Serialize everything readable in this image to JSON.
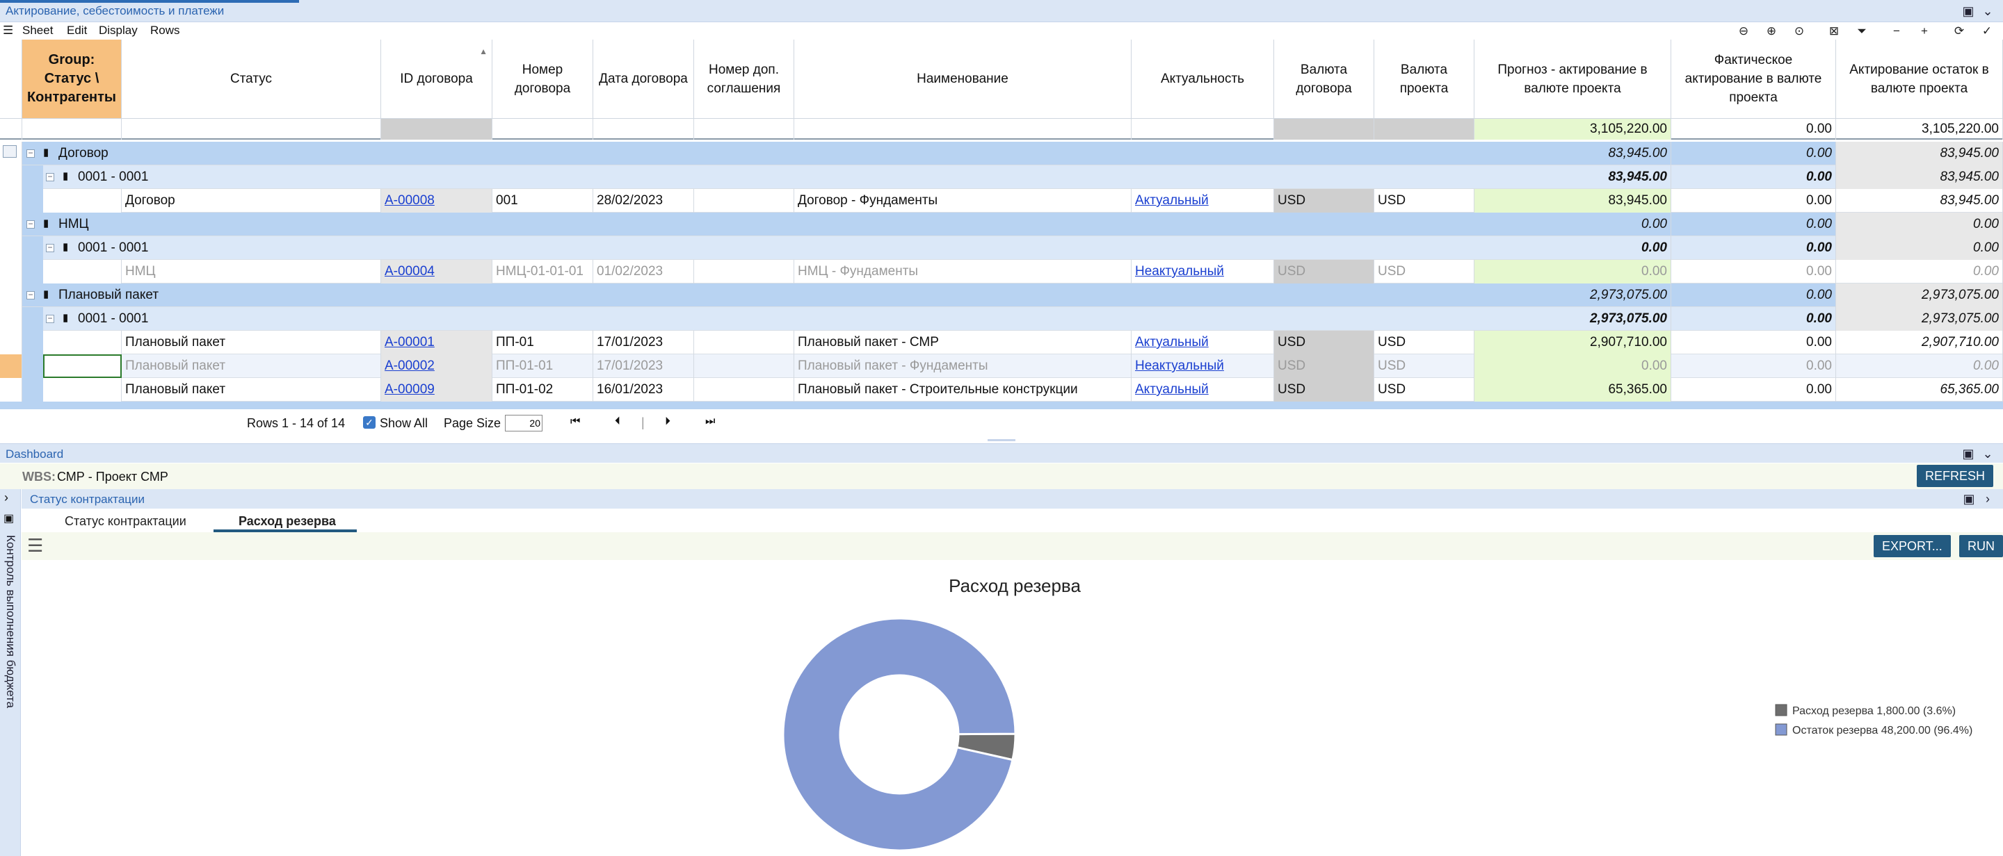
{
  "window": {
    "title": "Актирование, себестоимость и платежи"
  },
  "menu": [
    "Sheet",
    "Edit",
    "Display",
    "Rows"
  ],
  "columns": {
    "group": "Group: Статус \\ Контрагенты",
    "status": "Статус",
    "id": "ID договора",
    "number": "Номер договора",
    "date": "Дата договора",
    "addnum": "Номер доп. соглашения",
    "name": "Наименование",
    "actual": "Актуальность",
    "cur_contract": "Валюта договора",
    "cur_project": "Валюта проекта",
    "forecast": "Прогноз - актирование в валюте проекта",
    "fact": "Фактическое актирование в валюте проекта",
    "rest": "Актирование остаток в валюте проекта"
  },
  "totals": {
    "forecast": "3,105,220.00",
    "fact": "0.00",
    "rest": "3,105,220.00"
  },
  "rows": [
    {
      "kind": "g1",
      "label": "Договор",
      "forecast": "83,945.00",
      "fact": "0.00",
      "rest": "83,945.00"
    },
    {
      "kind": "g2",
      "label": "0001 - 0001",
      "forecast": "83,945.00",
      "fact": "0.00",
      "rest": "83,945.00"
    },
    {
      "kind": "d",
      "status": "Договор",
      "id": "A-00008",
      "number": "001",
      "date": "28/02/2023",
      "name": "Договор - Фундаменты",
      "actual": "Актуальный",
      "cc": "USD",
      "cp": "USD",
      "forecast": "83,945.00",
      "fact": "0.00",
      "rest": "83,945.00",
      "dim": false
    },
    {
      "kind": "g1",
      "label": "НМЦ",
      "forecast": "0.00",
      "fact": "0.00",
      "rest": "0.00"
    },
    {
      "kind": "g2",
      "label": "0001 - 0001",
      "forecast": "0.00",
      "fact": "0.00",
      "rest": "0.00"
    },
    {
      "kind": "d",
      "status": "НМЦ",
      "id": "A-00004",
      "number": "НМЦ-01-01-01",
      "date": "01/02/2023",
      "name": "НМЦ - Фундаменты",
      "actual": "Неактуальный",
      "cc": "USD",
      "cp": "USD",
      "forecast": "0.00",
      "fact": "0.00",
      "rest": "0.00",
      "dim": true
    },
    {
      "kind": "g1",
      "label": "Плановый пакет",
      "forecast": "2,973,075.00",
      "fact": "0.00",
      "rest": "2,973,075.00"
    },
    {
      "kind": "g2",
      "label": "0001 - 0001",
      "forecast": "2,973,075.00",
      "fact": "0.00",
      "rest": "2,973,075.00"
    },
    {
      "kind": "d",
      "status": "Плановый пакет",
      "id": "A-00001",
      "number": "ПП-01",
      "date": "17/01/2023",
      "name": "Плановый пакет - СМР",
      "actual": "Актуальный",
      "cc": "USD",
      "cp": "USD",
      "forecast": "2,907,710.00",
      "fact": "0.00",
      "rest": "2,907,710.00",
      "dim": false
    },
    {
      "kind": "d",
      "status": "Плановый пакет",
      "id": "A-00002",
      "number": "ПП-01-01",
      "date": "17/01/2023",
      "name": "Плановый пакет - Фундаменты",
      "actual": "Неактуальный",
      "cc": "USD",
      "cp": "USD",
      "forecast": "0.00",
      "fact": "0.00",
      "rest": "0.00",
      "dim": true,
      "selected": true
    },
    {
      "kind": "d",
      "status": "Плановый пакет",
      "id": "A-00009",
      "number": "ПП-01-02",
      "date": "16/01/2023",
      "name": "Плановый пакет - Строительные конструкции",
      "actual": "Актуальный",
      "cc": "USD",
      "cp": "USD",
      "forecast": "65,365.00",
      "fact": "0.00",
      "rest": "65,365.00",
      "dim": false
    }
  ],
  "pager": {
    "rows_text": "Rows 1 - 14 of 14",
    "show_all": "Show All",
    "page_size_label": "Page Size",
    "page_size": "20"
  },
  "dashboard": {
    "title": "Dashboard",
    "wbs_label": "WBS:",
    "wbs_value": "СМР - Проект СМР",
    "refresh": "REFRESH",
    "side_label": "Контроль выполнения бюджета",
    "panel_title": "Статус контрактации",
    "tabs": [
      "Статус контрактации",
      "Расход резерва"
    ],
    "export": "EXPORT...",
    "run": "RUN"
  },
  "chart_data": {
    "type": "pie",
    "title": "Расход резерва",
    "categories": [
      "Расход резерва",
      "Остаток резерва"
    ],
    "values": [
      1800,
      48200
    ],
    "legend_labels": [
      "Расход резерва 1,800.00 (3.6%)",
      "Остаток резерва 48,200.00 (96.4%)"
    ],
    "colors": [
      "#6e6e6e",
      "#8399d3"
    ],
    "donut": true,
    "legend": "right"
  }
}
